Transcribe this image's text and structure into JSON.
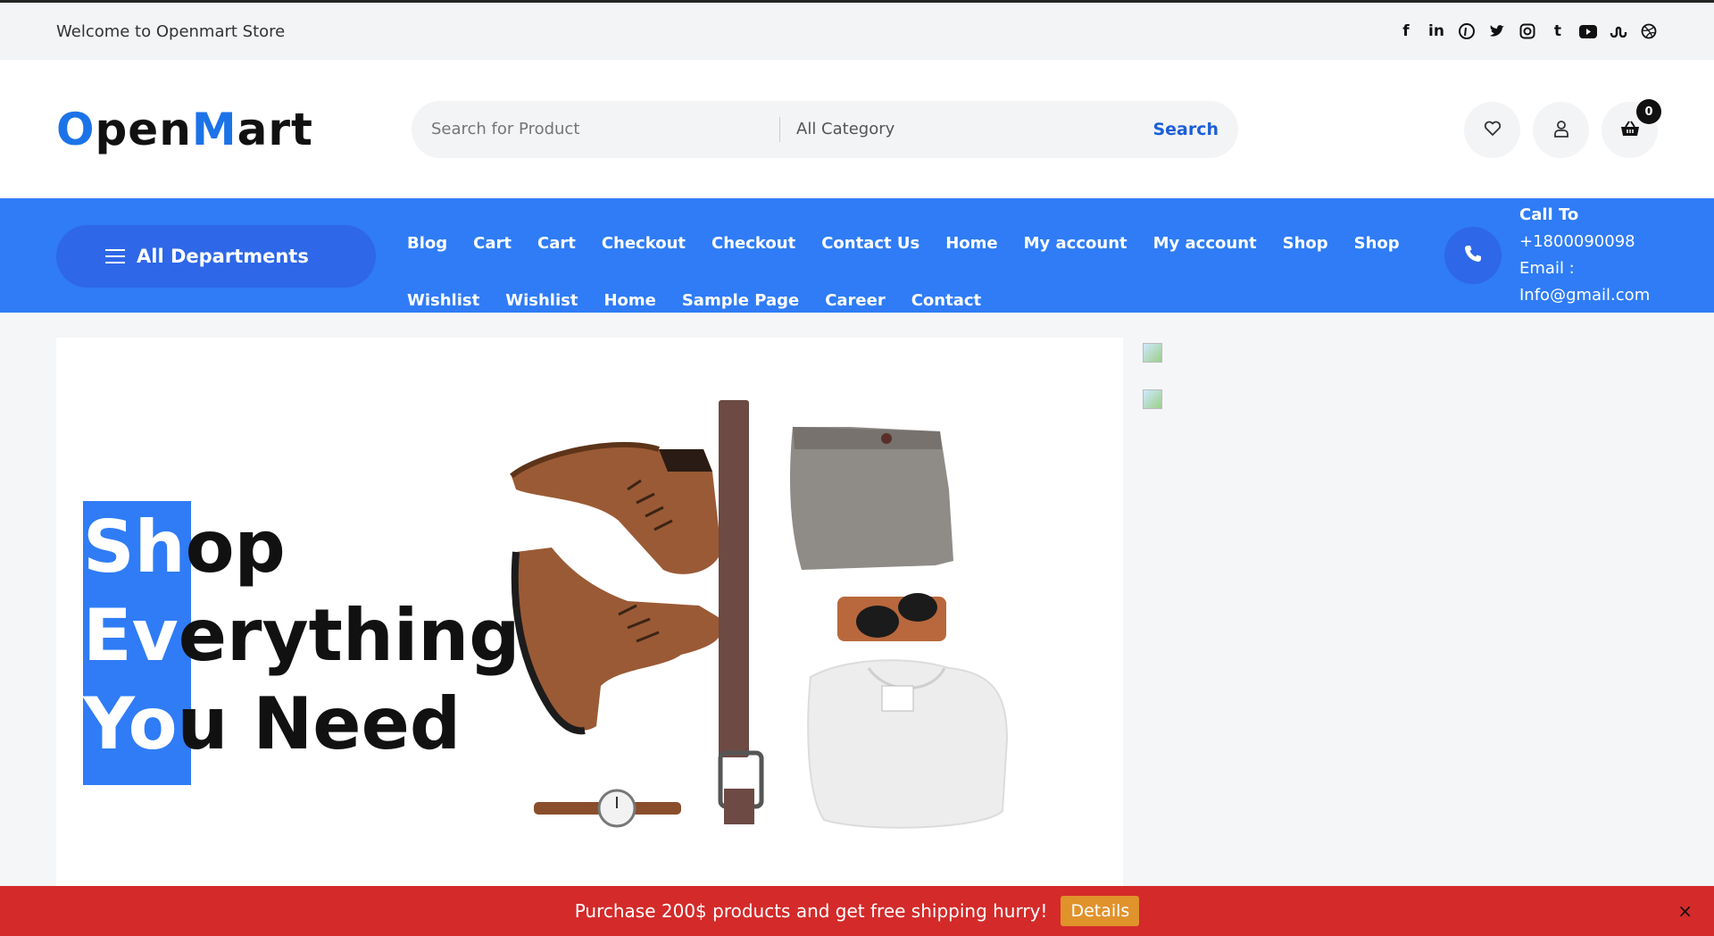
{
  "topbar": {
    "welcome": "Welcome to Openmart Store",
    "socials": [
      "facebook-icon",
      "linkedin-icon",
      "pinterest-icon",
      "twitter-icon",
      "instagram-icon",
      "tumblr-icon",
      "youtube-icon",
      "stumbleupon-icon",
      "dribbble-icon"
    ]
  },
  "header": {
    "logo_parts": [
      "O",
      "pen",
      "M",
      "art"
    ],
    "search_placeholder": "Search for Product",
    "category": "All Category",
    "search_label": "Search",
    "cart_count": "0"
  },
  "nav": {
    "departments_label": "All Departments",
    "row1": [
      "Blog",
      "Cart",
      "Cart",
      "Checkout",
      "Checkout",
      "Contact Us",
      "Home",
      "My account",
      "My account",
      "Shop",
      "Shop"
    ],
    "row2": [
      "Wishlist",
      "Wishlist",
      "Home",
      "Sample Page",
      "Career",
      "Contact"
    ],
    "call_label": "Call To",
    "phone": "+1800090098",
    "email_label": "Email :",
    "email": "Info@gmail.com"
  },
  "hero": {
    "line1_a": "Sh",
    "line1_b": "op",
    "line2_a": "Ev",
    "line2_b": "erything",
    "line3_a": "Yo",
    "line3_b": "u Need"
  },
  "promo": {
    "text": "Purchase 200$ products and get free shipping hurry!",
    "details_label": "Details",
    "close": "×"
  },
  "colors": {
    "accent": "#2f7cf6",
    "promo": "#d42a2a",
    "details": "#e0922b"
  }
}
